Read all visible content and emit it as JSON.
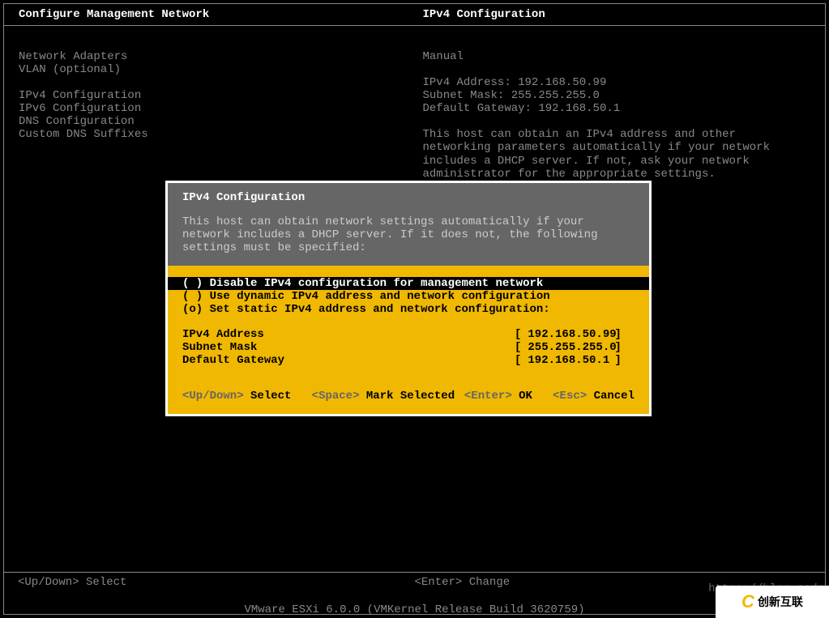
{
  "header": {
    "left": "Configure Management Network",
    "right": "IPv4 Configuration"
  },
  "leftMenu": {
    "block1": [
      "Network Adapters",
      "VLAN (optional)"
    ],
    "block2": [
      "IPv4 Configuration",
      "IPv6 Configuration",
      "DNS Configuration",
      "Custom DNS Suffixes"
    ]
  },
  "rightPanel": {
    "mode": "Manual",
    "lines": [
      {
        "label": "IPv4 Address:",
        "value": "192.168.50.99"
      },
      {
        "label": "Subnet Mask:",
        "value": "255.255.255.0"
      },
      {
        "label": "Default Gateway:",
        "value": "192.168.50.1"
      }
    ],
    "description": "This host can obtain an IPv4 address and other networking parameters automatically if your network includes a DHCP server. If not, ask your network administrator for the appropriate settings."
  },
  "dialog": {
    "title": "IPv4 Configuration",
    "description": "This host can obtain network settings automatically if your network includes a DHCP server. If it does not, the following settings must be specified:",
    "options": [
      {
        "marker": "( )",
        "text": "Disable IPv4 configuration for management network",
        "selected": true
      },
      {
        "marker": "( )",
        "text": "Use dynamic IPv4 address and network configuration",
        "selected": false
      },
      {
        "marker": "(o)",
        "text": "Set static IPv4 address and network configuration:",
        "selected": false
      }
    ],
    "fields": [
      {
        "label": "IPv4 Address",
        "value": "192.168.50.99"
      },
      {
        "label": "Subnet Mask",
        "value": "255.255.255.0"
      },
      {
        "label": "Default Gateway",
        "value": "192.168.50.1"
      }
    ],
    "footer": {
      "updown_key": "<Up/Down>",
      "updown_action": "Select",
      "space_key": "<Space>",
      "space_action": "Mark Selected",
      "enter_key": "<Enter>",
      "enter_action": "OK",
      "esc_key": "<Esc>",
      "esc_action": "Cancel"
    }
  },
  "bottomBar": {
    "left_key": "<Up/Down>",
    "left_action": "Select",
    "right_key": "<Enter>",
    "right_action": "Change"
  },
  "watermark": "https://blog.csdn",
  "version": "VMware ESXi 6.0.0 (VMKernel Release Build 3620759)",
  "logo": {
    "c": "C",
    "text": "创新互联"
  }
}
